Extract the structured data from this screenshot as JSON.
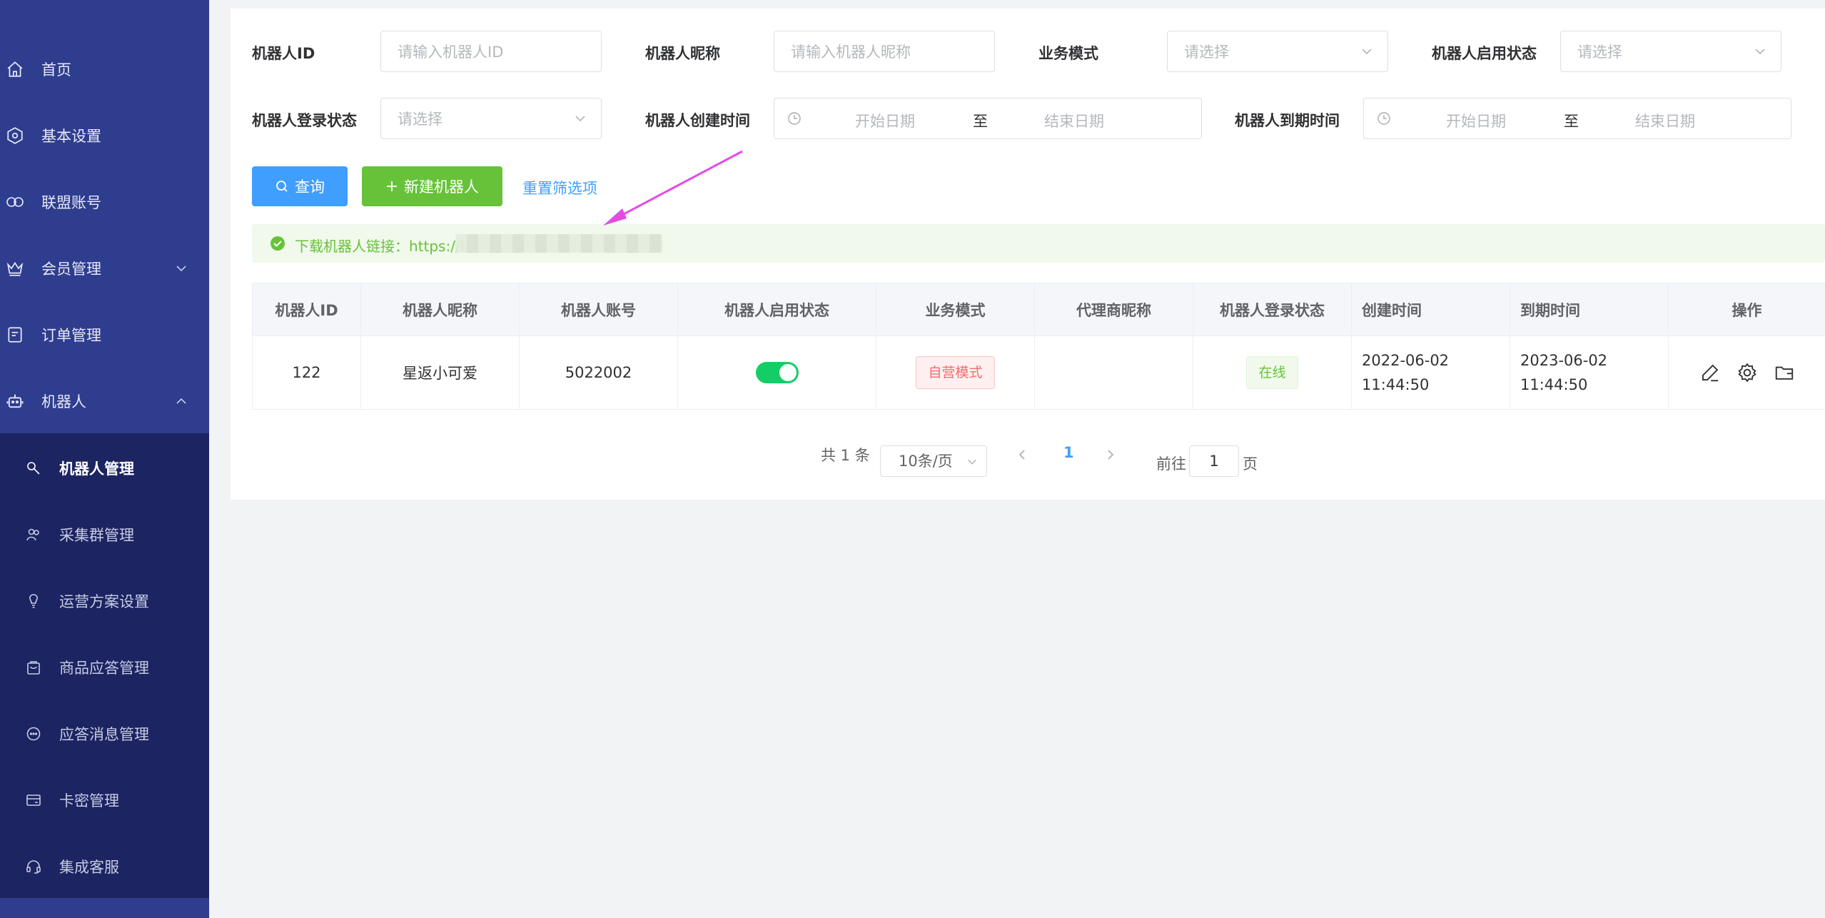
{
  "sidebar": {
    "items": [
      {
        "label": "首页",
        "icon": "home-icon"
      },
      {
        "label": "基本设置",
        "icon": "settings-icon"
      },
      {
        "label": "联盟账号",
        "icon": "link-icon"
      },
      {
        "label": "会员管理",
        "icon": "crown-icon"
      },
      {
        "label": "订单管理",
        "icon": "order-icon"
      },
      {
        "label": "机器人",
        "icon": "robot-icon"
      }
    ],
    "sub_items": [
      {
        "label": "机器人管理",
        "icon": "wrench-icon",
        "active": true
      },
      {
        "label": "采集群管理",
        "icon": "group-icon"
      },
      {
        "label": "运营方案设置",
        "icon": "bulb-icon"
      },
      {
        "label": "商品应答管理",
        "icon": "goods-icon"
      },
      {
        "label": "应答消息管理",
        "icon": "chat-icon"
      },
      {
        "label": "卡密管理",
        "icon": "card-icon"
      },
      {
        "label": "集成客服",
        "icon": "headset-icon"
      }
    ]
  },
  "filters": {
    "robot_id_label": "机器人ID",
    "robot_id_placeholder": "请输入机器人ID",
    "nickname_label": "机器人昵称",
    "nickname_placeholder": "请输入机器人昵称",
    "mode_label": "业务模式",
    "mode_placeholder": "请选择",
    "enable_label": "机器人启用状态",
    "enable_placeholder": "请选择",
    "login_label": "机器人登录状态",
    "login_placeholder": "请选择",
    "created_label": "机器人创建时间",
    "expire_label": "机器人到期时间",
    "start_placeholder": "开始日期",
    "range_sep": "至",
    "end_placeholder": "结束日期"
  },
  "actions": {
    "query": "查询",
    "new_robot": "新建机器人",
    "reset": "重置筛选项"
  },
  "alert": {
    "text": "下载机器人链接：https://l"
  },
  "table": {
    "headers": [
      "机器人ID",
      "机器人昵称",
      "机器人账号",
      "机器人启用状态",
      "业务模式",
      "代理商昵称",
      "机器人登录状态",
      "创建时间",
      "到期时间",
      "操作"
    ],
    "rows": [
      {
        "id": "122",
        "nickname": "星返小可爱",
        "account": "5022002",
        "enabled": true,
        "mode": "自营模式",
        "agent": "",
        "login": "在线",
        "created": "2022-06-02 11:44:50",
        "expire": "2023-06-02 11:44:50"
      }
    ]
  },
  "pagination": {
    "total": "共 1 条",
    "page_size": "10条/页",
    "current": "1",
    "goto_prefix": "前往",
    "goto_value": "1",
    "goto_suffix": "页"
  },
  "colors": {
    "sidebar": "#2f3d8f",
    "sidebar_sub": "#1c2462",
    "primary": "#409eff",
    "success": "#67c23a",
    "switch_on": "#13ce66",
    "arrow": "#e24be6"
  }
}
